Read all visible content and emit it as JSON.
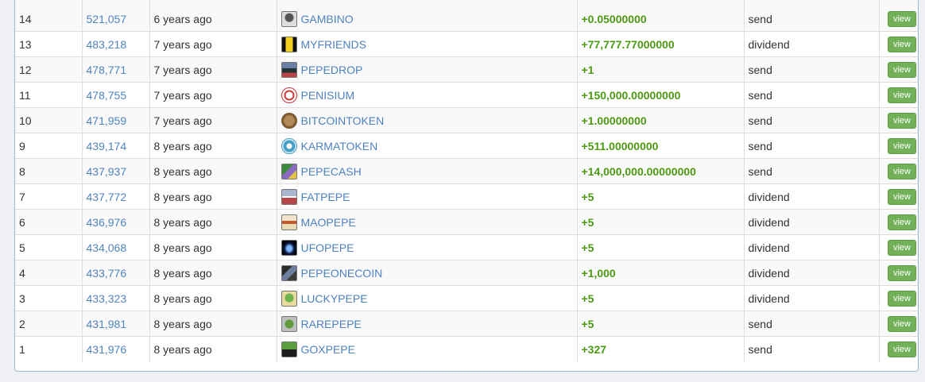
{
  "rows": [
    {
      "index": "14",
      "block": "521,057",
      "time": "6 years ago",
      "asset": "GAMBINO",
      "icon": "gambino-icon",
      "quantity": "+0.05000000",
      "type": "send",
      "action": "view"
    },
    {
      "index": "13",
      "block": "483,218",
      "time": "7 years ago",
      "asset": "MYFRIENDS",
      "icon": "myfriends-icon",
      "quantity": "+77,777.77000000",
      "type": "dividend",
      "action": "view"
    },
    {
      "index": "12",
      "block": "478,771",
      "time": "7 years ago",
      "asset": "PEPEDROP",
      "icon": "pepedrop-icon",
      "quantity": "+1",
      "type": "send",
      "action": "view"
    },
    {
      "index": "11",
      "block": "478,755",
      "time": "7 years ago",
      "asset": "PENISIUM",
      "icon": "penisium-icon",
      "quantity": "+150,000.00000000",
      "type": "send",
      "action": "view"
    },
    {
      "index": "10",
      "block": "471,959",
      "time": "7 years ago",
      "asset": "BITCOINTOKEN",
      "icon": "bitcointoken-icon",
      "quantity": "+1.00000000",
      "type": "send",
      "action": "view"
    },
    {
      "index": "9",
      "block": "439,174",
      "time": "8 years ago",
      "asset": "KARMATOKEN",
      "icon": "karmatoken-icon",
      "quantity": "+511.00000000",
      "type": "send",
      "action": "view"
    },
    {
      "index": "8",
      "block": "437,937",
      "time": "8 years ago",
      "asset": "PEPECASH",
      "icon": "pepecash-icon",
      "quantity": "+14,000,000.00000000",
      "type": "send",
      "action": "view"
    },
    {
      "index": "7",
      "block": "437,772",
      "time": "8 years ago",
      "asset": "FATPEPE",
      "icon": "fatpepe-icon",
      "quantity": "+5",
      "type": "dividend",
      "action": "view"
    },
    {
      "index": "6",
      "block": "436,976",
      "time": "8 years ago",
      "asset": "MAOPEPE",
      "icon": "maopepe-icon",
      "quantity": "+5",
      "type": "dividend",
      "action": "view"
    },
    {
      "index": "5",
      "block": "434,068",
      "time": "8 years ago",
      "asset": "UFOPEPE",
      "icon": "ufopepe-icon",
      "quantity": "+5",
      "type": "dividend",
      "action": "view"
    },
    {
      "index": "4",
      "block": "433,776",
      "time": "8 years ago",
      "asset": "PEPEONECOIN",
      "icon": "pepeonecoin-icon",
      "quantity": "+1,000",
      "type": "dividend",
      "action": "view"
    },
    {
      "index": "3",
      "block": "433,323",
      "time": "8 years ago",
      "asset": "LUCKYPEPE",
      "icon": "luckypepe-icon",
      "quantity": "+5",
      "type": "dividend",
      "action": "view"
    },
    {
      "index": "2",
      "block": "431,981",
      "time": "8 years ago",
      "asset": "RAREPEPE",
      "icon": "rarepepe-icon",
      "quantity": "+5",
      "type": "send",
      "action": "view"
    },
    {
      "index": "1",
      "block": "431,976",
      "time": "8 years ago",
      "asset": "GOXPEPE",
      "icon": "goxpepe-icon",
      "quantity": "+327",
      "type": "send",
      "action": "view"
    }
  ],
  "colors": {
    "link": "#4f82c0",
    "quantity": "#4a9b12",
    "view_button": "#72b05a",
    "panel_border": "#9fb7d0"
  }
}
